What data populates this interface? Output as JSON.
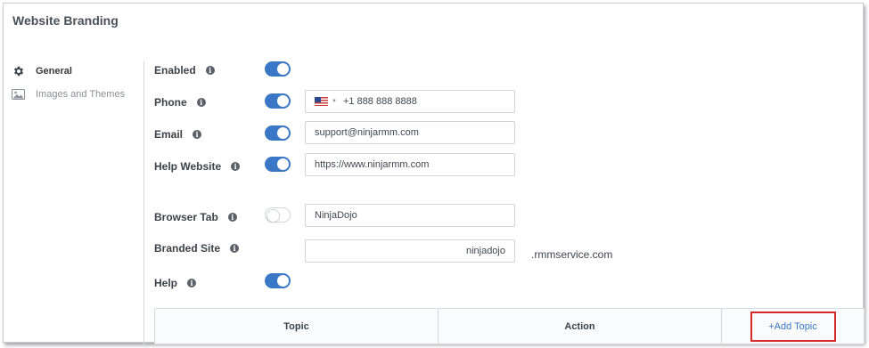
{
  "page": {
    "title": "Website Branding"
  },
  "sidebar": {
    "items": [
      {
        "label": "General",
        "icon": "gear-icon",
        "active": true
      },
      {
        "label": "Images and Themes",
        "icon": "image-icon",
        "active": false
      }
    ]
  },
  "settings": {
    "enabled": {
      "label": "Enabled",
      "on": true
    },
    "phone": {
      "label": "Phone",
      "on": true,
      "country_flag": "us-flag-icon",
      "value": "+1 888 888 8888"
    },
    "email": {
      "label": "Email",
      "on": true,
      "value": "support@ninjarmm.com"
    },
    "help_website": {
      "label": "Help Website",
      "on": true,
      "value": "https://www.ninjarmm.com"
    },
    "browser_tab": {
      "label": "Browser Tab",
      "on": false,
      "value": "NinjaDojo"
    },
    "branded_site": {
      "label": "Branded Site",
      "value": "ninjadojo",
      "suffix": ".rmmservice.com"
    },
    "help": {
      "label": "Help",
      "on": true
    }
  },
  "topics_table": {
    "columns": [
      "Topic",
      "Action"
    ],
    "add_label": "+Add Topic"
  },
  "colors": {
    "accent": "#3a77c6",
    "highlight": "#d42a2a"
  }
}
